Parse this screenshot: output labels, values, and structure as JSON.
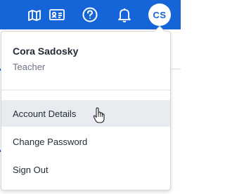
{
  "topbar": {
    "icons": [
      "map-icon",
      "id-card-icon",
      "help-icon",
      "notification-bell-icon"
    ],
    "avatar_initials": "CS",
    "colors": {
      "bar": "#1565d8",
      "icon": "#ffffff"
    }
  },
  "user_menu": {
    "name": "Cora Sadosky",
    "role": "Teacher",
    "items": [
      {
        "label": "Account Details",
        "hovered": true
      },
      {
        "label": "Change Password",
        "hovered": false
      },
      {
        "label": "Sign Out",
        "hovered": false
      }
    ]
  },
  "pointer": "hand-pointer-icon"
}
